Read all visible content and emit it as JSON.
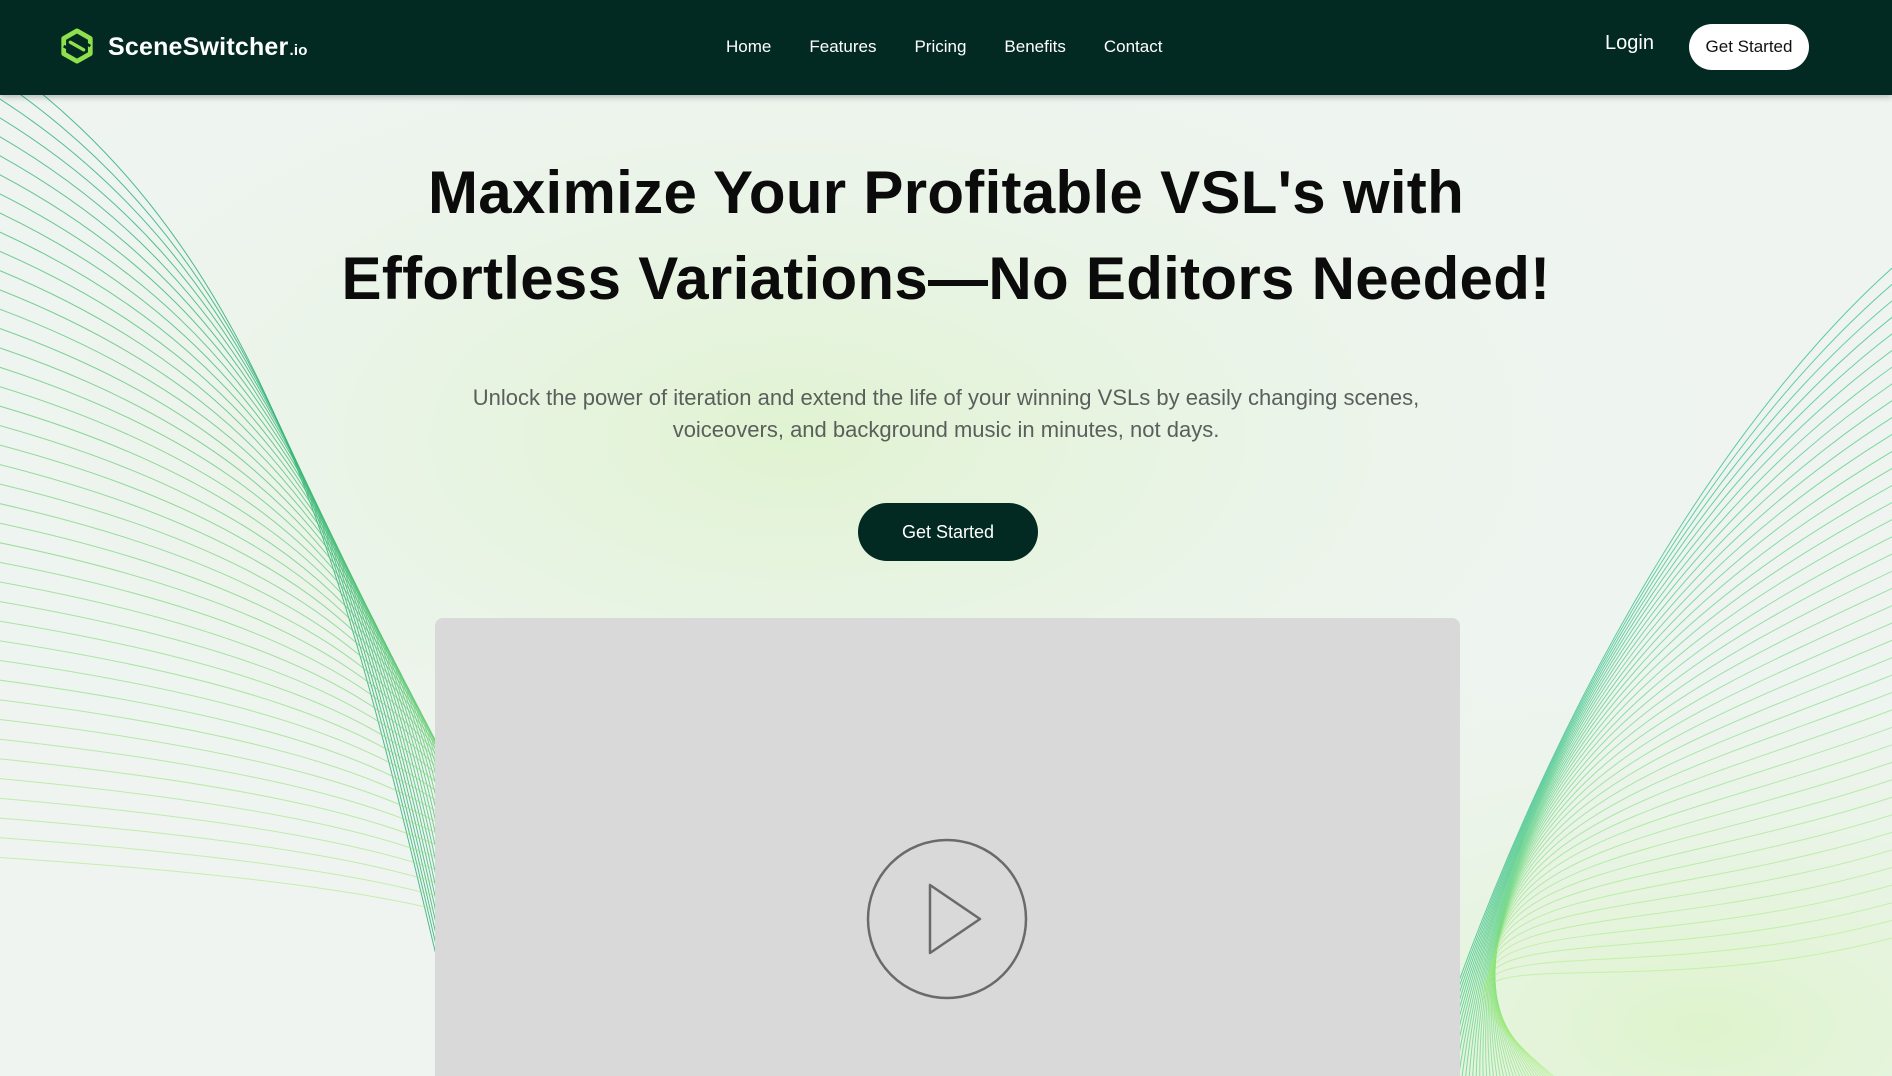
{
  "brand": {
    "name": "SceneSwitcher",
    "tld": ".io",
    "logo_icon": "interlocking-hexagon-logo",
    "accent": "#8ee04c",
    "dark": "#022922"
  },
  "nav": {
    "items": [
      {
        "label": "Home"
      },
      {
        "label": "Features"
      },
      {
        "label": "Pricing"
      },
      {
        "label": "Benefits"
      },
      {
        "label": "Contact"
      }
    ],
    "login_label": "Login",
    "cta_label": "Get Started"
  },
  "hero": {
    "headline_line1": "Maximize Your Profitable VSL's with",
    "headline_line2": "Effortless Variations—No Editors Needed!",
    "subhead_line1": "Unlock the power of iteration and extend the life of your winning VSLs by easily changing scenes,",
    "subhead_line2": "voiceovers, and background music in minutes, not days.",
    "cta_label": "Get Started"
  },
  "video": {
    "placeholder_color": "#d9d9d9",
    "icon": "play-icon"
  }
}
